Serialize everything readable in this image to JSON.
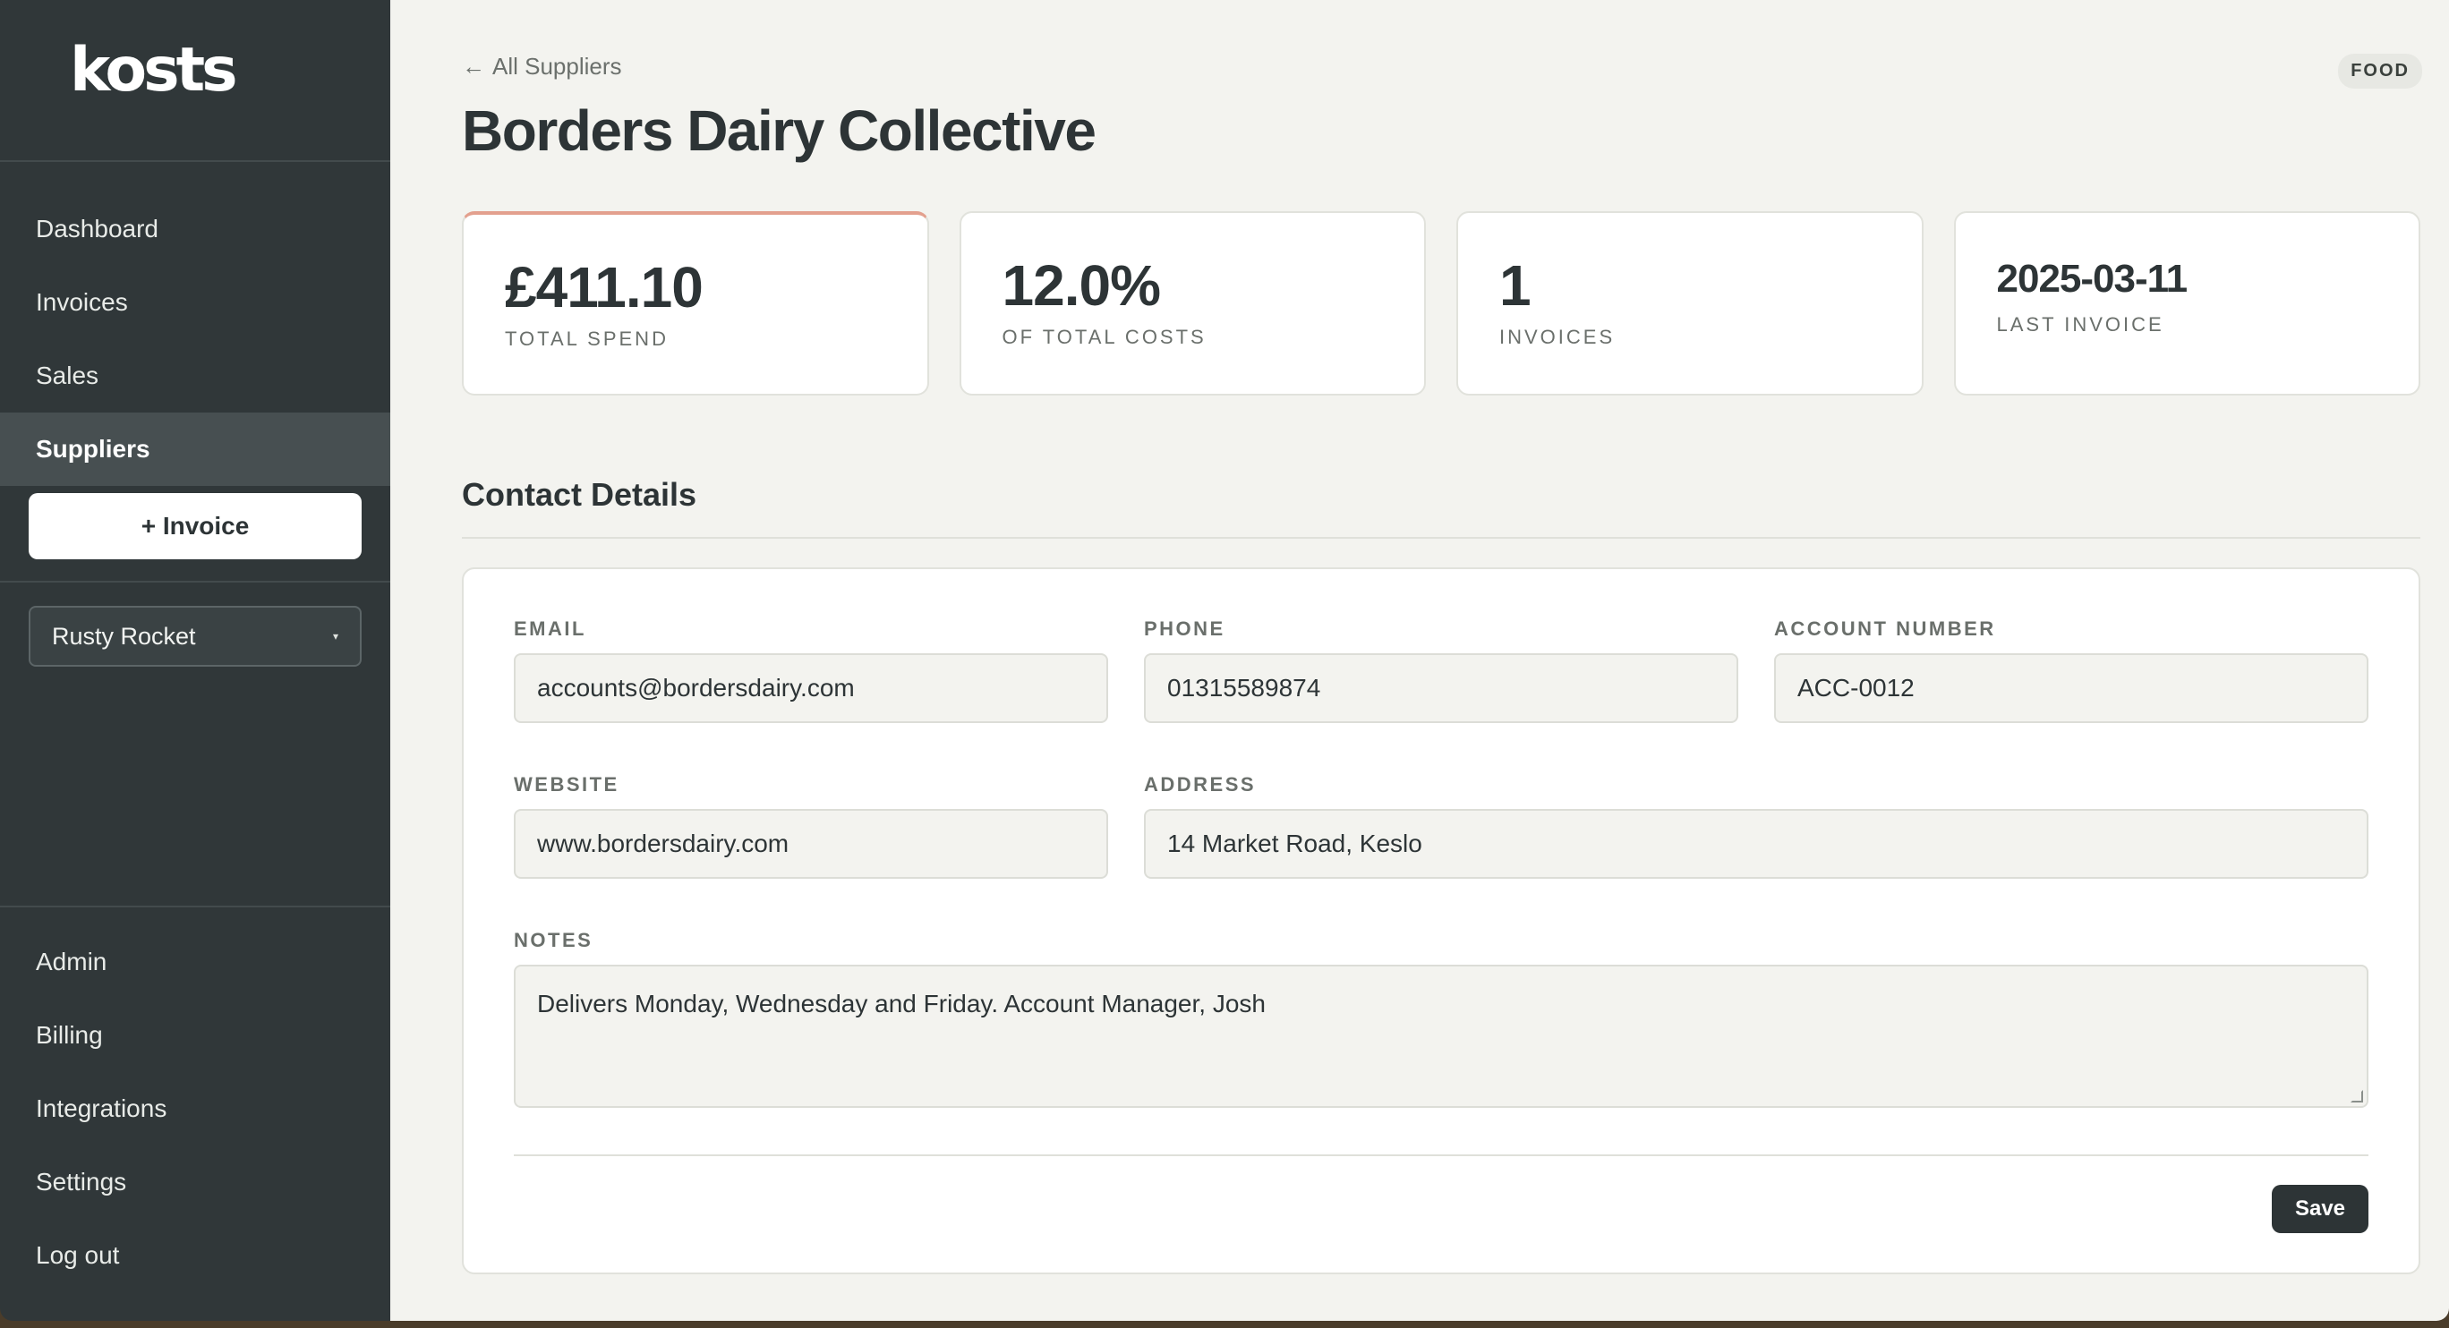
{
  "app": {
    "logo": "kosts"
  },
  "sidebar": {
    "nav": [
      {
        "label": "Dashboard"
      },
      {
        "label": "Invoices"
      },
      {
        "label": "Sales"
      },
      {
        "label": "Suppliers",
        "active": true
      }
    ],
    "new_invoice_label": "+ Invoice",
    "venue": {
      "selected": "Rusty Rocket",
      "caret": "▾"
    },
    "bottom_nav": [
      {
        "label": "Admin"
      },
      {
        "label": "Billing"
      },
      {
        "label": "Integrations"
      },
      {
        "label": "Settings"
      },
      {
        "label": "Log out"
      }
    ]
  },
  "header": {
    "back_label": "All Suppliers",
    "back_arrow": "←",
    "title": "Borders Dairy Collective",
    "category_tag": "FOOD"
  },
  "stats": [
    {
      "value": "£411.10",
      "label": "TOTAL SPEND"
    },
    {
      "value": "12.0%",
      "label": "OF TOTAL COSTS"
    },
    {
      "value": "1",
      "label": "INVOICES"
    },
    {
      "value": "2025-03-11",
      "label": "LAST INVOICE"
    }
  ],
  "contact": {
    "section_title": "Contact Details",
    "email": {
      "label": "EMAIL",
      "value": "accounts@bordersdairy.com"
    },
    "phone": {
      "label": "PHONE",
      "value": "01315589874"
    },
    "account_number": {
      "label": "ACCOUNT NUMBER",
      "value": "ACC-0012"
    },
    "website": {
      "label": "WEBSITE",
      "value": "www.bordersdairy.com"
    },
    "address": {
      "label": "ADDRESS",
      "value": "14 Market Road, Keslo"
    },
    "notes": {
      "label": "NOTES",
      "value": "Delivers Monday, Wednesday and Friday. Account Manager, Josh"
    },
    "save_label": "Save"
  },
  "colors": {
    "sidebar_bg": "#303739",
    "main_bg": "#f3f3ef",
    "accent_border": "#e3a08e",
    "primary_button": "#2d3436"
  }
}
